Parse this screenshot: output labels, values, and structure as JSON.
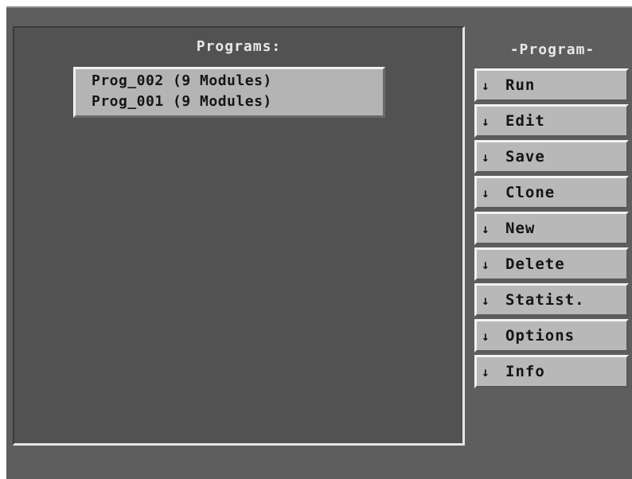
{
  "main": {
    "title": "Programs:",
    "programs": [
      "Prog_002 (9 Modules)",
      "Prog_001 (9 Modules)"
    ]
  },
  "sidebar": {
    "title": "-Program-",
    "arrow_glyph": "↓",
    "buttons": [
      {
        "label": "Run"
      },
      {
        "label": "Edit"
      },
      {
        "label": "Save"
      },
      {
        "label": "Clone"
      },
      {
        "label": "New"
      },
      {
        "label": "Delete"
      },
      {
        "label": "Statist."
      },
      {
        "label": "Options"
      },
      {
        "label": "Info"
      }
    ]
  },
  "colors": {
    "background": "#5e5e5e",
    "panel": "#525252",
    "button_face": "#b8b8b8",
    "title_text": "#e8e8e8"
  }
}
